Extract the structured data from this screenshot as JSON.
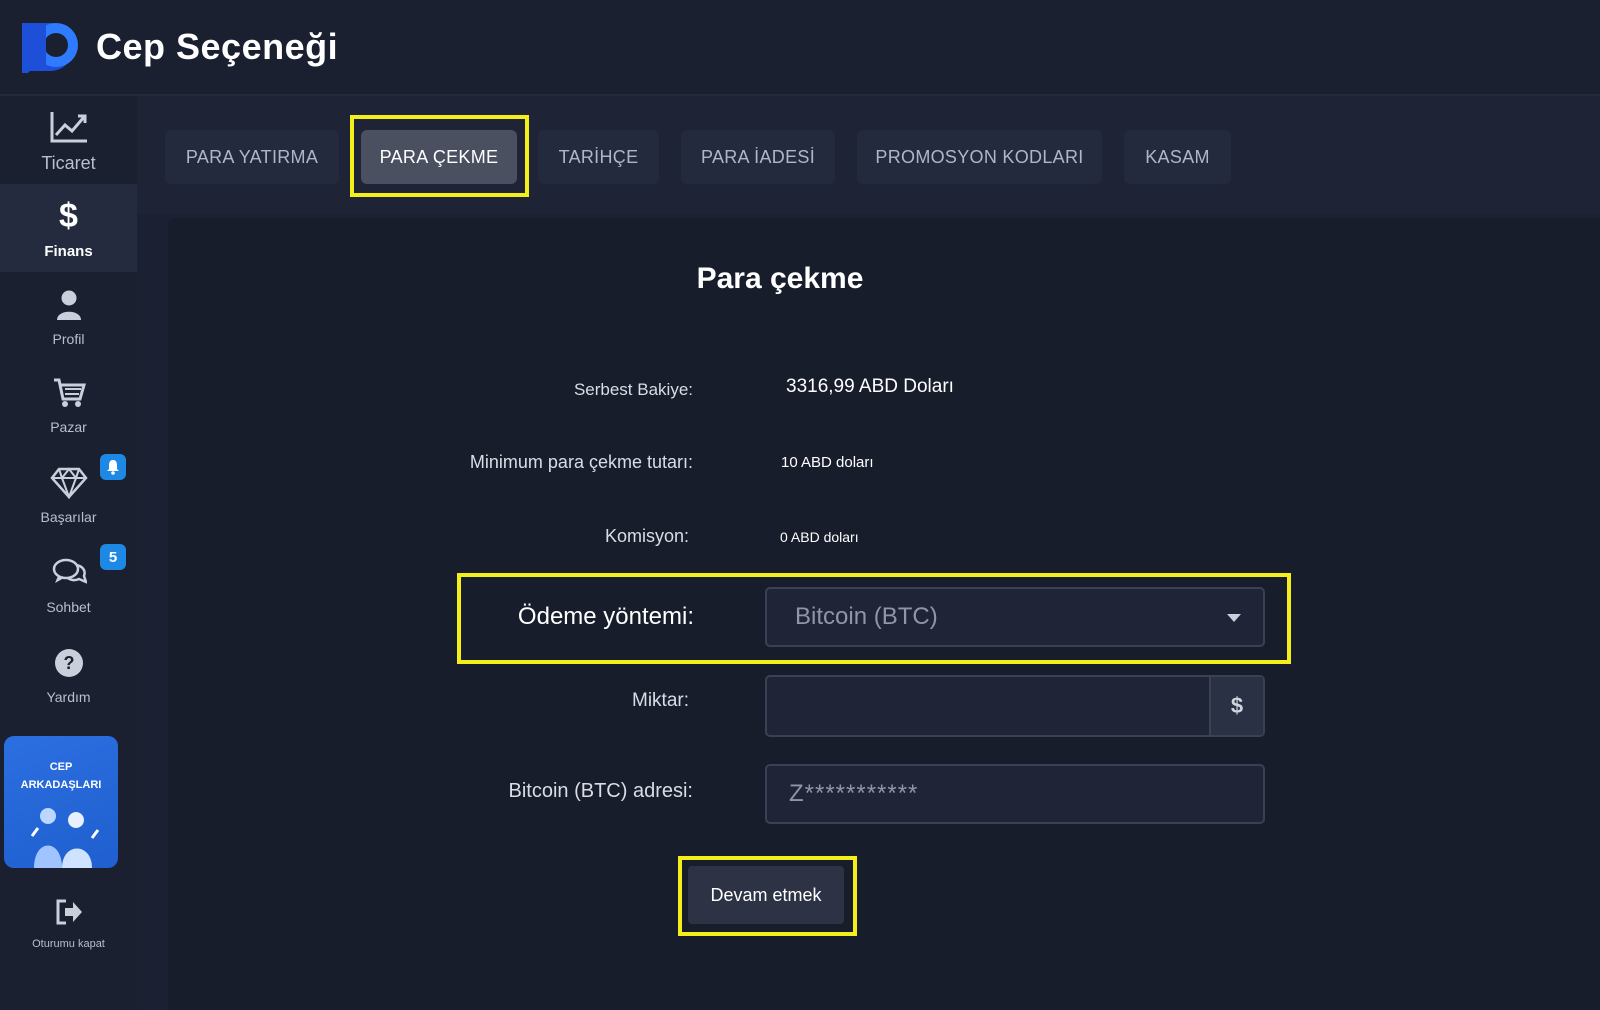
{
  "app": {
    "title": "Cep Seçeneği"
  },
  "sidebar": {
    "items": [
      {
        "label": "Ticaret",
        "icon": "chart-line-icon"
      },
      {
        "label": "Finans",
        "icon": "dollar-icon"
      },
      {
        "label": "Profil",
        "icon": "user-icon"
      },
      {
        "label": "Pazar",
        "icon": "cart-icon"
      },
      {
        "label": "Başarılar",
        "icon": "diamond-icon"
      },
      {
        "label": "Sohbet",
        "icon": "chat-icon"
      },
      {
        "label": "Yardım",
        "icon": "help-icon"
      }
    ],
    "chat_badge": "5",
    "promo": {
      "line1": "CEP",
      "line2": "ARKADAŞLARI"
    },
    "logout": {
      "label": "Oturumu kapat"
    }
  },
  "tabs": [
    {
      "label": "PARA YATIRMA"
    },
    {
      "label": "PARA ÇEKME"
    },
    {
      "label": "TARİHÇE"
    },
    {
      "label": "PARA İADESİ"
    },
    {
      "label": "PROMOSYON KODLARI"
    },
    {
      "label": "KASAM"
    }
  ],
  "form": {
    "title": "Para çekme",
    "balance_label": "Serbest Bakiye:",
    "balance_value": "3316,99 ABD Doları",
    "min_label": "Minimum para çekme tutarı:",
    "min_value": "10 ABD doları",
    "commission_label": "Komisyon:",
    "commission_value": "0 ABD doları",
    "method_label": "Ödeme yöntemi:",
    "method_value": "Bitcoin (BTC)",
    "amount_label": "Miktar:",
    "amount_value": "",
    "amount_currency": "$",
    "address_label": "Bitcoin (BTC) adresi:",
    "address_value": "Z***********",
    "submit_label": "Devam etmek"
  },
  "colors": {
    "highlight": "#f4ee1a",
    "accent_blue": "#1e88e5"
  }
}
